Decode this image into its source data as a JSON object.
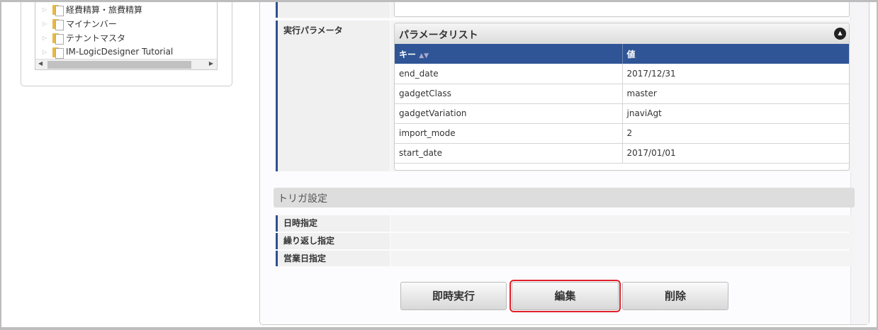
{
  "tree": {
    "items": [
      {
        "label": "経費精算・旅費精算"
      },
      {
        "label": "マイナンバー"
      },
      {
        "label": "テナントマスタ"
      },
      {
        "label": "IM-LogicDesigner Tutorial"
      }
    ]
  },
  "params": {
    "label": "実行パラメータ",
    "list_title": "パラメータリスト",
    "col_key": "キー",
    "col_value": "値",
    "rows": [
      {
        "key": "end_date",
        "value": "2017/12/31"
      },
      {
        "key": "gadgetClass",
        "value": "master"
      },
      {
        "key": "gadgetVariation",
        "value": "jnaviAgt"
      },
      {
        "key": "import_mode",
        "value": "2"
      },
      {
        "key": "start_date",
        "value": "2017/01/01"
      }
    ],
    "header_color": "#2f5597"
  },
  "trigger": {
    "title": "トリガ設定",
    "rows": [
      {
        "label": "日時指定"
      },
      {
        "label": "繰り返し指定"
      },
      {
        "label": "営業日指定"
      }
    ]
  },
  "buttons": {
    "run": "即時実行",
    "edit": "編集",
    "delete": "削除",
    "highlight_color": "#e0202a"
  }
}
